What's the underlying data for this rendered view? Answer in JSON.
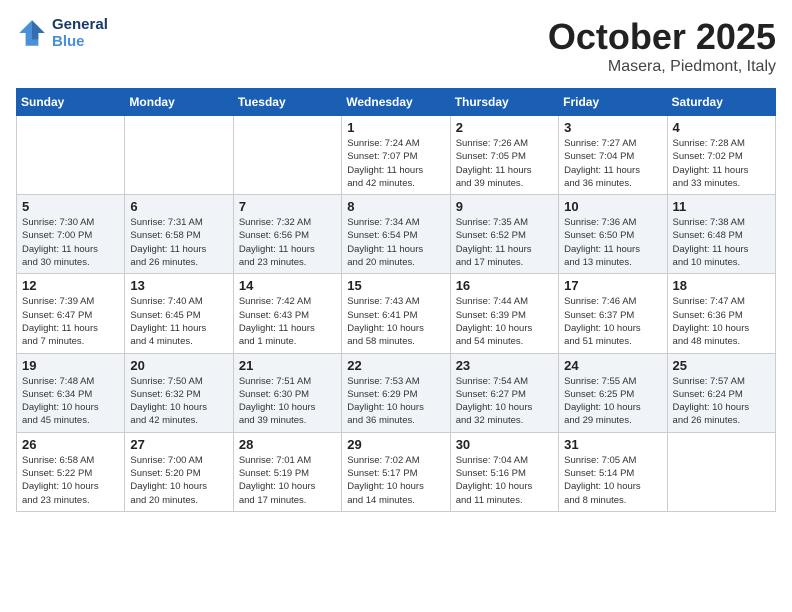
{
  "header": {
    "logo_line1": "General",
    "logo_line2": "Blue",
    "month": "October 2025",
    "location": "Masera, Piedmont, Italy"
  },
  "weekdays": [
    "Sunday",
    "Monday",
    "Tuesday",
    "Wednesday",
    "Thursday",
    "Friday",
    "Saturday"
  ],
  "weeks": [
    [
      {
        "day": "",
        "info": ""
      },
      {
        "day": "",
        "info": ""
      },
      {
        "day": "",
        "info": ""
      },
      {
        "day": "1",
        "info": "Sunrise: 7:24 AM\nSunset: 7:07 PM\nDaylight: 11 hours\nand 42 minutes."
      },
      {
        "day": "2",
        "info": "Sunrise: 7:26 AM\nSunset: 7:05 PM\nDaylight: 11 hours\nand 39 minutes."
      },
      {
        "day": "3",
        "info": "Sunrise: 7:27 AM\nSunset: 7:04 PM\nDaylight: 11 hours\nand 36 minutes."
      },
      {
        "day": "4",
        "info": "Sunrise: 7:28 AM\nSunset: 7:02 PM\nDaylight: 11 hours\nand 33 minutes."
      }
    ],
    [
      {
        "day": "5",
        "info": "Sunrise: 7:30 AM\nSunset: 7:00 PM\nDaylight: 11 hours\nand 30 minutes."
      },
      {
        "day": "6",
        "info": "Sunrise: 7:31 AM\nSunset: 6:58 PM\nDaylight: 11 hours\nand 26 minutes."
      },
      {
        "day": "7",
        "info": "Sunrise: 7:32 AM\nSunset: 6:56 PM\nDaylight: 11 hours\nand 23 minutes."
      },
      {
        "day": "8",
        "info": "Sunrise: 7:34 AM\nSunset: 6:54 PM\nDaylight: 11 hours\nand 20 minutes."
      },
      {
        "day": "9",
        "info": "Sunrise: 7:35 AM\nSunset: 6:52 PM\nDaylight: 11 hours\nand 17 minutes."
      },
      {
        "day": "10",
        "info": "Sunrise: 7:36 AM\nSunset: 6:50 PM\nDaylight: 11 hours\nand 13 minutes."
      },
      {
        "day": "11",
        "info": "Sunrise: 7:38 AM\nSunset: 6:48 PM\nDaylight: 11 hours\nand 10 minutes."
      }
    ],
    [
      {
        "day": "12",
        "info": "Sunrise: 7:39 AM\nSunset: 6:47 PM\nDaylight: 11 hours\nand 7 minutes."
      },
      {
        "day": "13",
        "info": "Sunrise: 7:40 AM\nSunset: 6:45 PM\nDaylight: 11 hours\nand 4 minutes."
      },
      {
        "day": "14",
        "info": "Sunrise: 7:42 AM\nSunset: 6:43 PM\nDaylight: 11 hours\nand 1 minute."
      },
      {
        "day": "15",
        "info": "Sunrise: 7:43 AM\nSunset: 6:41 PM\nDaylight: 10 hours\nand 58 minutes."
      },
      {
        "day": "16",
        "info": "Sunrise: 7:44 AM\nSunset: 6:39 PM\nDaylight: 10 hours\nand 54 minutes."
      },
      {
        "day": "17",
        "info": "Sunrise: 7:46 AM\nSunset: 6:37 PM\nDaylight: 10 hours\nand 51 minutes."
      },
      {
        "day": "18",
        "info": "Sunrise: 7:47 AM\nSunset: 6:36 PM\nDaylight: 10 hours\nand 48 minutes."
      }
    ],
    [
      {
        "day": "19",
        "info": "Sunrise: 7:48 AM\nSunset: 6:34 PM\nDaylight: 10 hours\nand 45 minutes."
      },
      {
        "day": "20",
        "info": "Sunrise: 7:50 AM\nSunset: 6:32 PM\nDaylight: 10 hours\nand 42 minutes."
      },
      {
        "day": "21",
        "info": "Sunrise: 7:51 AM\nSunset: 6:30 PM\nDaylight: 10 hours\nand 39 minutes."
      },
      {
        "day": "22",
        "info": "Sunrise: 7:53 AM\nSunset: 6:29 PM\nDaylight: 10 hours\nand 36 minutes."
      },
      {
        "day": "23",
        "info": "Sunrise: 7:54 AM\nSunset: 6:27 PM\nDaylight: 10 hours\nand 32 minutes."
      },
      {
        "day": "24",
        "info": "Sunrise: 7:55 AM\nSunset: 6:25 PM\nDaylight: 10 hours\nand 29 minutes."
      },
      {
        "day": "25",
        "info": "Sunrise: 7:57 AM\nSunset: 6:24 PM\nDaylight: 10 hours\nand 26 minutes."
      }
    ],
    [
      {
        "day": "26",
        "info": "Sunrise: 6:58 AM\nSunset: 5:22 PM\nDaylight: 10 hours\nand 23 minutes."
      },
      {
        "day": "27",
        "info": "Sunrise: 7:00 AM\nSunset: 5:20 PM\nDaylight: 10 hours\nand 20 minutes."
      },
      {
        "day": "28",
        "info": "Sunrise: 7:01 AM\nSunset: 5:19 PM\nDaylight: 10 hours\nand 17 minutes."
      },
      {
        "day": "29",
        "info": "Sunrise: 7:02 AM\nSunset: 5:17 PM\nDaylight: 10 hours\nand 14 minutes."
      },
      {
        "day": "30",
        "info": "Sunrise: 7:04 AM\nSunset: 5:16 PM\nDaylight: 10 hours\nand 11 minutes."
      },
      {
        "day": "31",
        "info": "Sunrise: 7:05 AM\nSunset: 5:14 PM\nDaylight: 10 hours\nand 8 minutes."
      },
      {
        "day": "",
        "info": ""
      }
    ]
  ]
}
